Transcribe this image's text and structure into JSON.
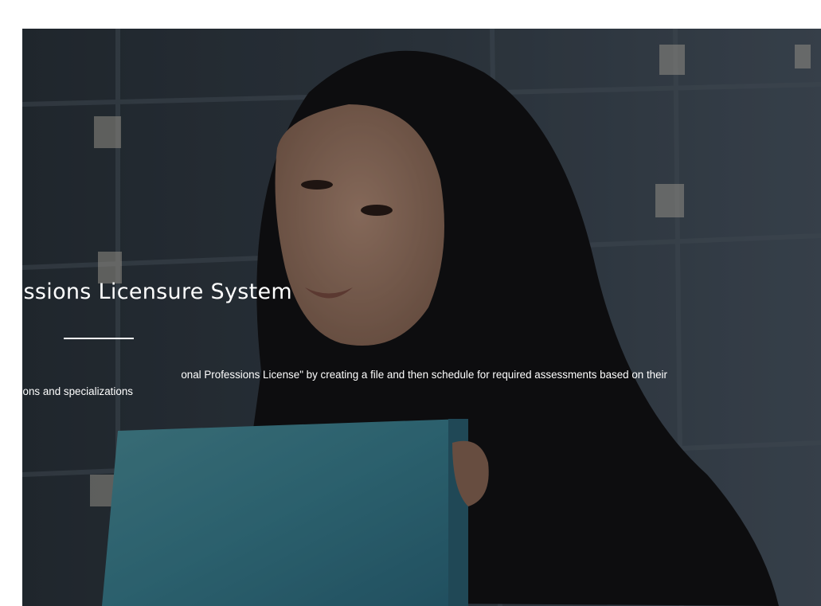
{
  "hero": {
    "title": "ofessions Licensure System",
    "description_line1": "onal Professions License\" by creating a file and then schedule for required assessments based on their",
    "description_line2": "ifications and specializations"
  }
}
